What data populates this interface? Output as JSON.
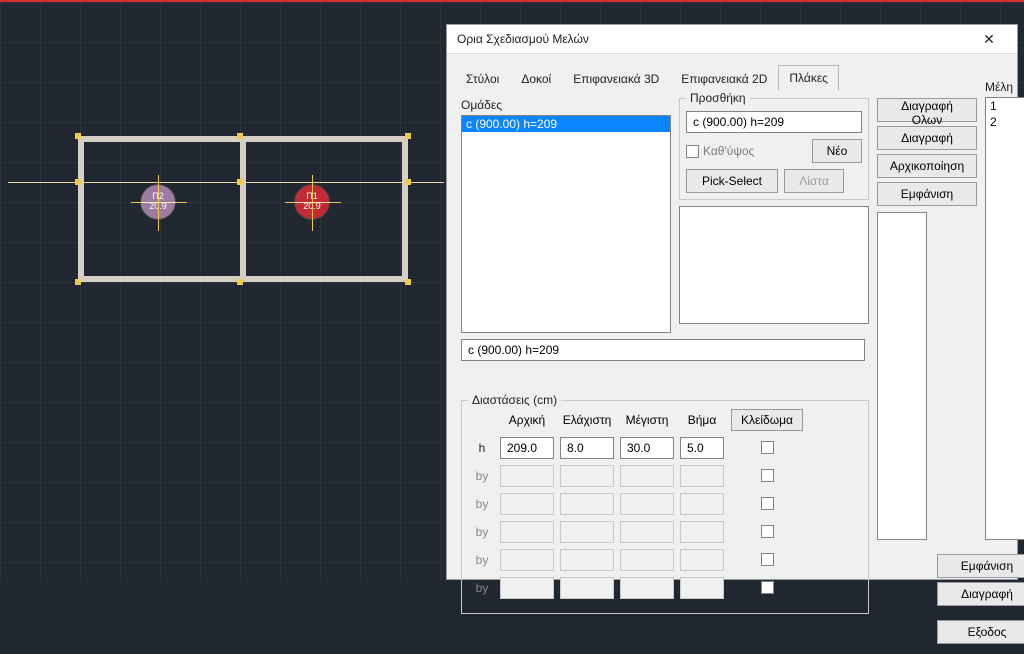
{
  "dialog": {
    "title": "Ορια Σχεδιασμού Μελών",
    "tabs": [
      "Στύλοι",
      "Δοκοί",
      "Επιφανειακά 3D",
      "Επιφανειακά 2D",
      "Πλάκες"
    ],
    "active_tab": 4,
    "groups_label": "Ομάδες",
    "groups_items": [
      "c (900.00) h=209"
    ],
    "groups_selected": 0,
    "group_edit": "c (900.00) h=209",
    "add_group_label": "Προσθήκη",
    "add_value": "c (900.00) h=209",
    "per_height_label": "Καθ'ύψος",
    "new_btn": "Νέο",
    "pick_btn": "Pick-Select",
    "list_btn": "Λίστα",
    "side_btns": {
      "delete_all": "Διαγραφή Ολων",
      "delete": "Διαγραφή",
      "init": "Αρχικοποίηση",
      "show": "Εμφάνιση"
    },
    "members_label": "Μέλη",
    "members": [
      "1",
      "2"
    ],
    "member_btns": {
      "show": "Εμφάνιση",
      "delete": "Διαγραφή",
      "exit": "Εξοδος"
    },
    "dim_label": "Διαστάσεις (cm)",
    "dim_headers": {
      "initial": "Αρχική",
      "min": "Ελάχιστη",
      "max": "Μέγιστη",
      "step": "Βήμα",
      "lock": "Κλείδωμα"
    },
    "dim_rows": [
      {
        "label": "h",
        "initial": "209.0",
        "min": "8.0",
        "max": "30.0",
        "step": "5.0",
        "active": true
      },
      {
        "label": "by",
        "initial": "",
        "min": "",
        "max": "",
        "step": "",
        "active": false
      },
      {
        "label": "by",
        "initial": "",
        "min": "",
        "max": "",
        "step": "",
        "active": false
      },
      {
        "label": "by",
        "initial": "",
        "min": "",
        "max": "",
        "step": "",
        "active": false
      },
      {
        "label": "by",
        "initial": "",
        "min": "",
        "max": "",
        "step": "",
        "active": false
      },
      {
        "label": "by",
        "initial": "",
        "min": "",
        "max": "",
        "step": "",
        "active": false
      }
    ]
  },
  "cad": {
    "slabs": [
      {
        "name": "Π1",
        "value": "20.9",
        "color": "#c22b34"
      },
      {
        "name": "Π2",
        "value": "20.9",
        "color": "#9e7ca1"
      }
    ]
  }
}
